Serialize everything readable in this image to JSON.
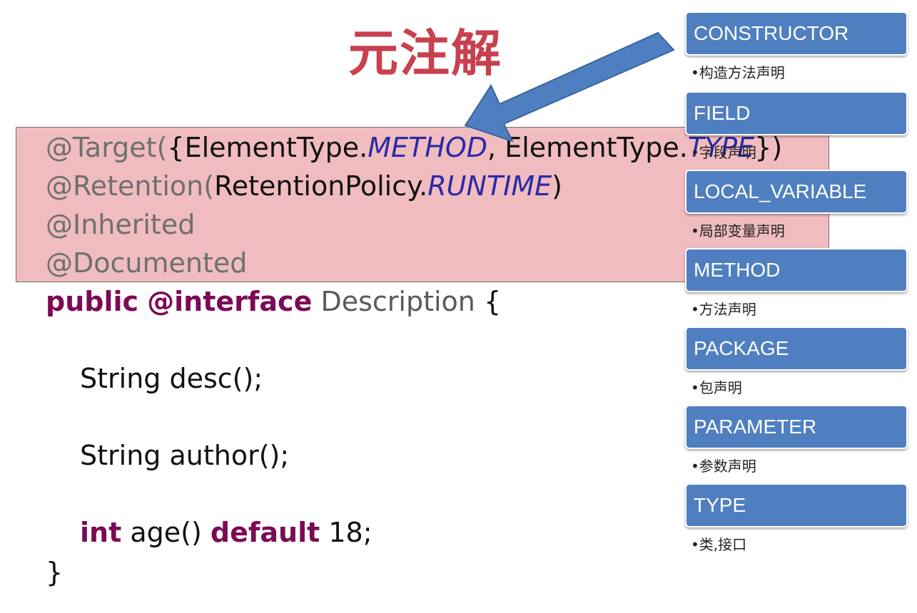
{
  "slide": {
    "title": "元注解",
    "code": {
      "line1": {
        "prefix": "@Target(",
        "p1": "{ElementType.",
        "v1": "METHOD",
        "p2": ", ElementType.",
        "v2": "TYPE",
        "p3": "})"
      },
      "line2": {
        "prefix": "@Retention(",
        "p1": "RetentionPolicy.",
        "v1": "RUNTIME",
        "p2": ")"
      },
      "line3": "@Inherited",
      "line4": "@Documented",
      "line5": {
        "kw1": "public",
        "kw2": "@interface",
        "name": "Description",
        "brace": "{"
      },
      "line6": "String desc();",
      "line7": "String author();",
      "line8": {
        "kw1": "int",
        "mid": "age()",
        "kw2": "default",
        "val": "18;"
      },
      "line9": "}"
    },
    "element_types": [
      {
        "name": "CONSTRUCTOR",
        "desc": "•构造方法声明"
      },
      {
        "name": "FIELD",
        "desc": "•字段声明"
      },
      {
        "name": "LOCAL_VARIABLE",
        "desc": "•局部变量声明"
      },
      {
        "name": "METHOD",
        "desc": "•方法声明"
      },
      {
        "name": "PACKAGE",
        "desc": "•包声明"
      },
      {
        "name": "PARAMETER",
        "desc": "•参数声明"
      },
      {
        "name": "TYPE",
        "desc": "•类,接口"
      }
    ],
    "colors": {
      "title": "#c8414f",
      "box": "#f0bcbf",
      "header": "#4f7fc0",
      "arrow": "#4f7fc0"
    }
  }
}
